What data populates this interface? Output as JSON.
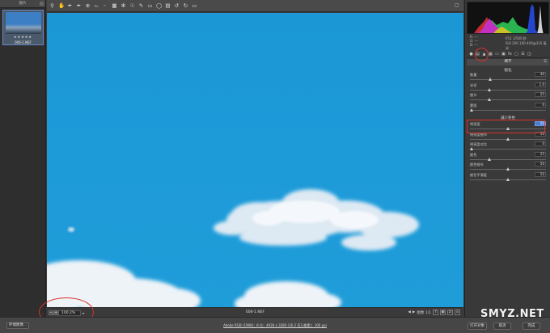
{
  "filmstrip": {
    "header": "图片",
    "thumbnail": {
      "stars": "★★★★★",
      "filename": "006-1.NEF"
    }
  },
  "toolbar": {
    "tools": [
      "zoom-icon",
      "hand-icon",
      "white-balance-icon",
      "color-sampler-icon",
      "target-adjust-icon",
      "crop-icon",
      "straighten-icon",
      "transform-icon",
      "spot-removal-icon",
      "red-eye-icon",
      "adjustment-brush-icon",
      "graduated-filter-icon",
      "radial-filter-icon",
      "preferences-icon",
      "rotate-left-icon",
      "rotate-right-icon",
      "trash-icon"
    ]
  },
  "histogram": {
    "colors": {
      "red": "#e23030",
      "green": "#2fd15a",
      "blue": "#2a4ff0",
      "magenta": "#e236e2",
      "yellow": "#e8e22a"
    }
  },
  "info": {
    "l1": "R:  ---",
    "l2": "G:  ---",
    "l3": "B:  ---",
    "r1": "f/11   1/500 秒",
    "r2": "ISO 200   100-400@310 毫米"
  },
  "panel": {
    "tab_label": "细节",
    "section1_title": "锐化",
    "sharpen": [
      {
        "label": "数量",
        "value": "40",
        "pos": 0.27
      },
      {
        "label": "半径",
        "value": "1.0",
        "pos": 0.25
      },
      {
        "label": "细节",
        "value": "25",
        "pos": 0.25
      },
      {
        "label": "蒙版",
        "value": "0",
        "pos": 0.02
      }
    ],
    "section2_title": "减少杂色",
    "noise": [
      {
        "label": "明亮度",
        "value": "50",
        "pos": 0.5,
        "highlight": true
      },
      {
        "label": "明亮度细节",
        "value": "50",
        "pos": 0.5
      },
      {
        "label": "明亮度对比",
        "value": "0",
        "pos": 0.02
      },
      {
        "label": "颜色",
        "value": "25",
        "pos": 0.25
      },
      {
        "label": "颜色细节",
        "value": "50",
        "pos": 0.5
      },
      {
        "label": "颜色平滑度",
        "value": "50",
        "pos": 0.5
      }
    ]
  },
  "status": {
    "zoom": "100.2%",
    "filename": "006-1.NEF",
    "image_counter": "图像 1/1"
  },
  "bottom": {
    "save_label": "存储图像...",
    "workflow_info": "Adobe RGB (1998)；8 位；4928 x 3280 (16.2 百万像素)；300 ppi",
    "open_label": "打开对象",
    "cancel_label": "取消",
    "done_label": "完成"
  },
  "watermark": "SMYZ.NET",
  "accents": {
    "highlight_red": "#d8332a",
    "selection_blue": "#4a7bd5"
  }
}
